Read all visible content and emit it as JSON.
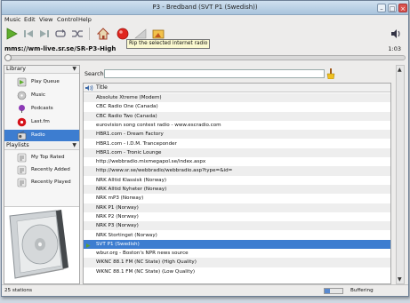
{
  "window": {
    "title": "P3 - Bredband (SVT P1 (Swedish))"
  },
  "menu": [
    "Music",
    "Edit",
    "View",
    "Control",
    "Help"
  ],
  "toolbar": {
    "tooltip": "Rip the selected internet radio station"
  },
  "stream": {
    "url": "mms://wm-live.sr.se/SR-P3-High",
    "elapsed": "1:03"
  },
  "sidebar": {
    "library_label": "Library",
    "library_items": [
      {
        "label": "Play Queue",
        "icon": "play-queue-icon"
      },
      {
        "label": "Music",
        "icon": "music-icon"
      },
      {
        "label": "Podcasts",
        "icon": "podcast-icon"
      },
      {
        "label": "Last.fm",
        "icon": "lastfm-icon"
      },
      {
        "label": "Radio",
        "icon": "radio-icon",
        "selected": true
      }
    ],
    "playlists_label": "Playlists",
    "playlist_items": [
      {
        "label": "My Top Rated",
        "icon": "smart-playlist-icon"
      },
      {
        "label": "Recently Added",
        "icon": "smart-playlist-icon"
      },
      {
        "label": "Recently Played",
        "icon": "smart-playlist-icon"
      }
    ]
  },
  "search": {
    "label": "Search:",
    "value": ""
  },
  "list": {
    "column": "Title",
    "rows": [
      "Absolute Xtreme (Modem)",
      "CBC Radio One (Canada)",
      "CBC Radio Two (Canada)",
      "eurovision song contest radio - www.escradio.com",
      "HBR1.com - Dream Factory",
      "HBR1.com - I.D.M. Tranceponder",
      "HBR1.com - Tronic Lounge",
      "http://webbradio.mixmegapol.se/index.aspx",
      "http://www.sr.se/webbradio/webbradio.asp?type=&id=",
      "NRK Alltid Klassisk (Norway)",
      "NRK Alltid Nyheter (Norway)",
      "NRK mP3 (Norway)",
      "NRK P1 (Norway)",
      "NRK P2 (Norway)",
      "NRK P3 (Norway)",
      "NRK Stortinget (Norway)",
      "SVT P1 (Swedish)",
      "wbur.org - Boston's NPR news source",
      "WKNC 88.1 FM (NC State) (High Quality)",
      "WKNC 88.1 FM (NC State) (Low Quality)"
    ],
    "selected_index": 16
  },
  "status": {
    "count": "25 stations",
    "state": "Buffering",
    "buffer_fraction": 0.3
  }
}
